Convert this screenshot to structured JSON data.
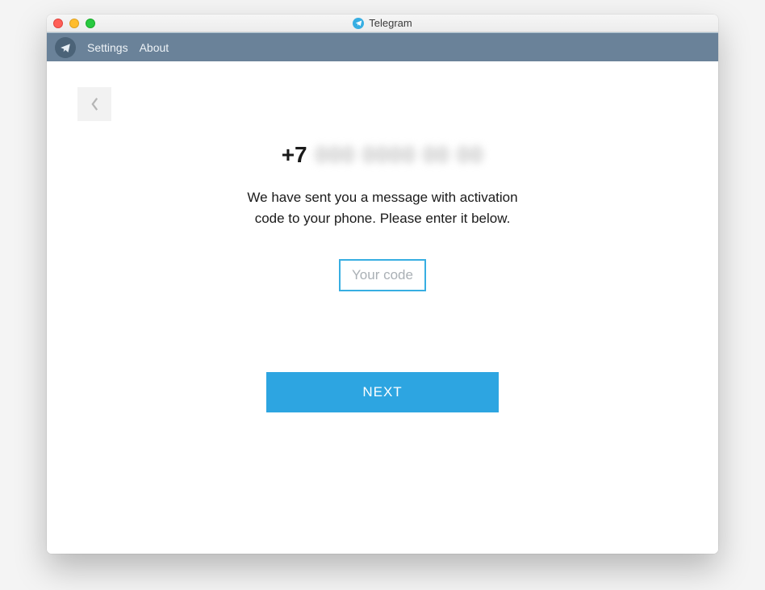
{
  "window": {
    "title": "Telegram"
  },
  "menubar": {
    "settings_label": "Settings",
    "about_label": "About"
  },
  "main": {
    "phone_prefix": "+7",
    "phone_rest_masked": "000 0000 00 00",
    "subtitle_line1": "We have sent you a message with activation",
    "subtitle_line2": "code to your phone. Please enter it below.",
    "code_placeholder": "Your code",
    "code_value": "",
    "next_label": "NEXT"
  }
}
